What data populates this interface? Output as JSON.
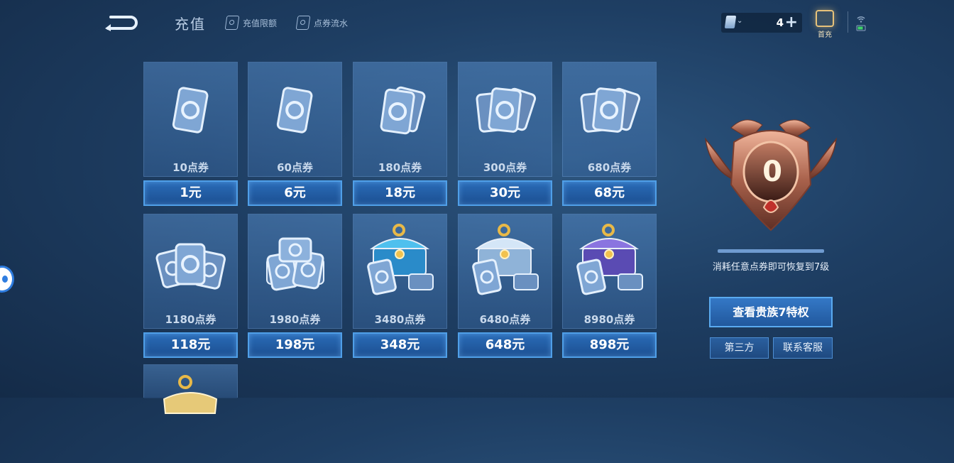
{
  "header": {
    "title": "充值",
    "links": [
      {
        "label": "充值限额",
        "icon": "ticket-icon"
      },
      {
        "label": "点券流水",
        "icon": "ticket-icon"
      }
    ],
    "balance": {
      "amount": "4",
      "icon": "voucher-icon",
      "add_icon": "plus-icon"
    },
    "first_recharge": {
      "label": "首充",
      "icon": "gift-icon"
    }
  },
  "packs": [
    {
      "amount": "10点券",
      "price": "1元",
      "art": "single-ticket"
    },
    {
      "amount": "60点券",
      "price": "6元",
      "art": "single-ticket"
    },
    {
      "amount": "180点券",
      "price": "18元",
      "art": "ticket-pair"
    },
    {
      "amount": "300点券",
      "price": "30元",
      "art": "ticket-fan"
    },
    {
      "amount": "680点券",
      "price": "68元",
      "art": "ticket-fan"
    },
    {
      "amount": "1180点券",
      "price": "118元",
      "art": "ticket-pile"
    },
    {
      "amount": "1980点券",
      "price": "198元",
      "art": "ticket-stack"
    },
    {
      "amount": "3480点券",
      "price": "348元",
      "art": "chest-blue"
    },
    {
      "amount": "6480点券",
      "price": "648元",
      "art": "chest-silver"
    },
    {
      "amount": "8980点券",
      "price": "898元",
      "art": "chest-purple"
    }
  ],
  "nobility": {
    "level": "0",
    "progress": 1.0,
    "description": "消耗任意点券即可恢复到7级",
    "privilege_button": "查看贵族7特权",
    "third_party_button": "第三方",
    "support_button": "联系客服"
  },
  "colors": {
    "accent": "#2f7de0",
    "price_btn": "#21589d",
    "badge": "#b5705a"
  }
}
